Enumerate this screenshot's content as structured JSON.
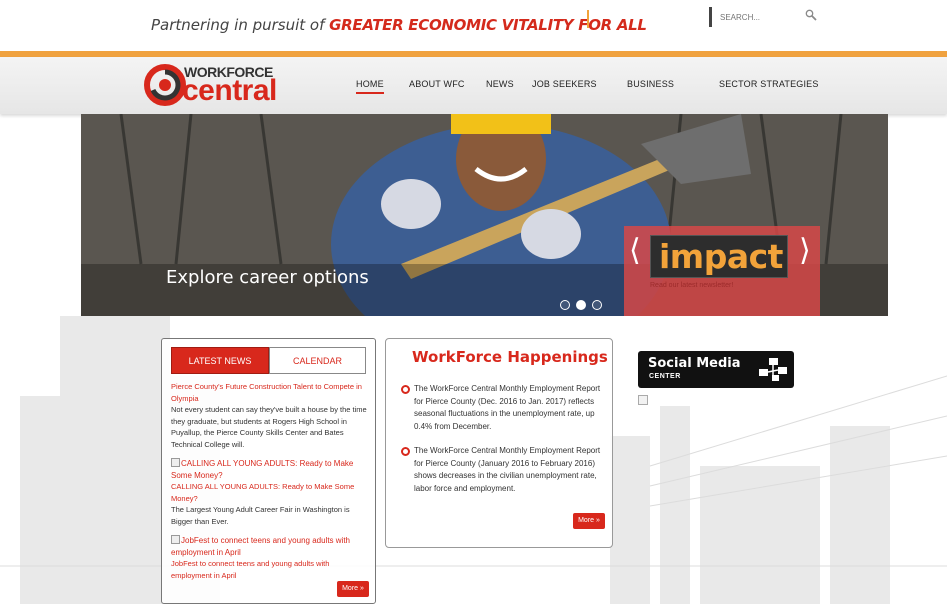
{
  "top": {
    "tagline_lead": "Partnering in pursuit of ",
    "tagline_strong": "GREATER ECONOMIC VITALITY FOR ALL",
    "search_placeholder": "SEARCH...",
    "search_icon": "magnifier-icon"
  },
  "brand": {
    "logo_top": "WORKFORCE",
    "logo_bottom": "central",
    "accent_red": "#d8281c",
    "accent_orange": "#f0a23f"
  },
  "nav": {
    "items": [
      "HOME",
      "ABOUT WFC",
      "NEWS",
      "JOB SEEKERS",
      "BUSINESS",
      "SECTOR STRATEGIES"
    ],
    "active": "HOME"
  },
  "hero": {
    "caption": "Explore career options",
    "slides": 3,
    "active_slide": 2
  },
  "impact": {
    "word": "impact",
    "left_arrow": "⟨",
    "right_arrow": "⟩",
    "subtext": "Read our latest newsletter!"
  },
  "news": {
    "tab_latest": "LATEST NEWS",
    "tab_calendar": "CALENDAR",
    "item1_title": "Pierce County's Future Construction Talent to Compete in Olympia",
    "item1_text": "Not every student can say they've built a house by the time they graduate, but students at Rogers High School in Puyallup, the Pierce County Skills Center and Bates Technical College will.",
    "item2_img_alt": "CALLING ALL YOUNG ADULTS: Ready to Make Some Money?",
    "item2_title": "CALLING ALL YOUNG ADULTS: Ready to Make Some Money?",
    "item2_text": "The Largest Young Adult Career Fair in Washington is Bigger than Ever.",
    "item3_img_alt": "JobFest to connect teens and young adults with employment in April",
    "item3_title": "JobFest to connect teens and young adults with employment in April",
    "more_label": "More »"
  },
  "happenings": {
    "title": "WorkForce Happenings",
    "item1": "The WorkForce Central Monthly Employment Report for Pierce County (Dec. 2016 to Jan. 2017) reflects seasonal fluctuations in the unemployment rate, up 0.4% from December.",
    "item2": "The WorkForce Central Monthly Employment Report for Pierce County (January 2016 to February 2016) shows decreases in the civilian unemployment rate, labor force and employment.",
    "more_label": "More »"
  },
  "social": {
    "line1": "Social Media",
    "line2": "CENTER",
    "icon": "network-icon"
  }
}
